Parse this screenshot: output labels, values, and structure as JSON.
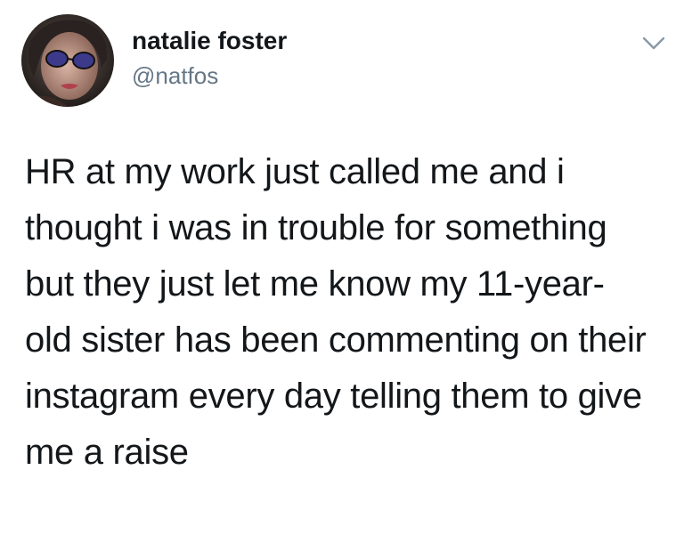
{
  "author": {
    "display_name": "natalie foster",
    "handle": "@natfos"
  },
  "icons": {
    "avatar": "profile-photo",
    "menu": "chevron-down-icon"
  },
  "colors": {
    "text": "#14171a",
    "secondary_text": "#657786",
    "background": "#ffffff"
  },
  "tweet": {
    "lines": [
      "HR at my work just called me and i",
      "thought i was in trouble for something",
      "but they just let me know my 11-year-",
      "old sister has been commenting on their",
      "instagram every day telling them to give",
      "me a raise"
    ]
  }
}
